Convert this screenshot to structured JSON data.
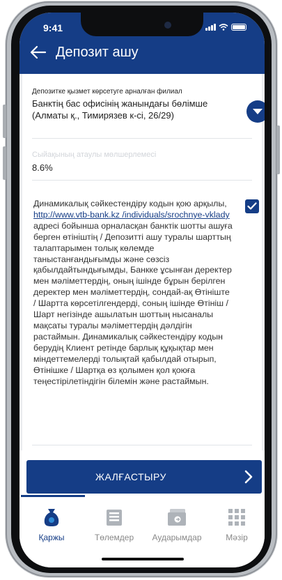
{
  "status_bar": {
    "time": "9:41"
  },
  "header": {
    "title": "Депозит ашу"
  },
  "branch": {
    "label": "Депозитке қызмет көрсетуге арналған филиал",
    "value": "Банктің бас офисінің жанындағы бөлімше (Алматы қ., Тимирязев к-сі, 26/29)"
  },
  "rate": {
    "label": "Сыйақының атаулы мөлшерлемесі",
    "value": "8.6%"
  },
  "consent": {
    "text_before": "Динамикалық сәйкестендіру кодын қою арқылы, ",
    "link": "http://www.vtb-bank.kz /individuals/srochnye-vklady",
    "text_after": " адресі бойынша орналасқан банктік шотты ашуға берген өтінiштің / Депозитті ашу туралы шарттың талаптарымен толық көлемде таныстанғандығымды және сөзсіз қабылдайтындығымды, Банкке ұсынған деректер мен мәліметтердің,  оның ішінде бұрын берілген деректер мен мәліметтердің, сондай-ақ Өтініште / Шартта көрсетілгендерді, соның ішінде Өтініш / Шарт негізінде ашылатын шоттың нысаналы мақсаты туралы мәліметтердің дәлдігін растаймын. Динамикалық сәйкестендіру кодын берудің Клиент ретінде барлық құқықтар мен міндеттемелерді толықтай қабылдай отырып, Өтінішке / Шартқа өз қолымен қол қоюға теңестірілетіндігін білемін және растаймын.",
    "checked": true
  },
  "continue_button": {
    "label": "ЖАЛҒАСТЫРУ"
  },
  "tabs": [
    {
      "label": "Қаржы",
      "icon": "money-bag-icon",
      "active": true
    },
    {
      "label": "Төлемдер",
      "icon": "payments-list-icon",
      "active": false
    },
    {
      "label": "Аударымдар",
      "icon": "wallet-transfer-icon",
      "active": false
    },
    {
      "label": "Мәзір",
      "icon": "grid-menu-icon",
      "active": false
    }
  ],
  "colors": {
    "brand": "#153d86",
    "inactive_tab": "#888888",
    "placeholder": "#d2d5da"
  }
}
